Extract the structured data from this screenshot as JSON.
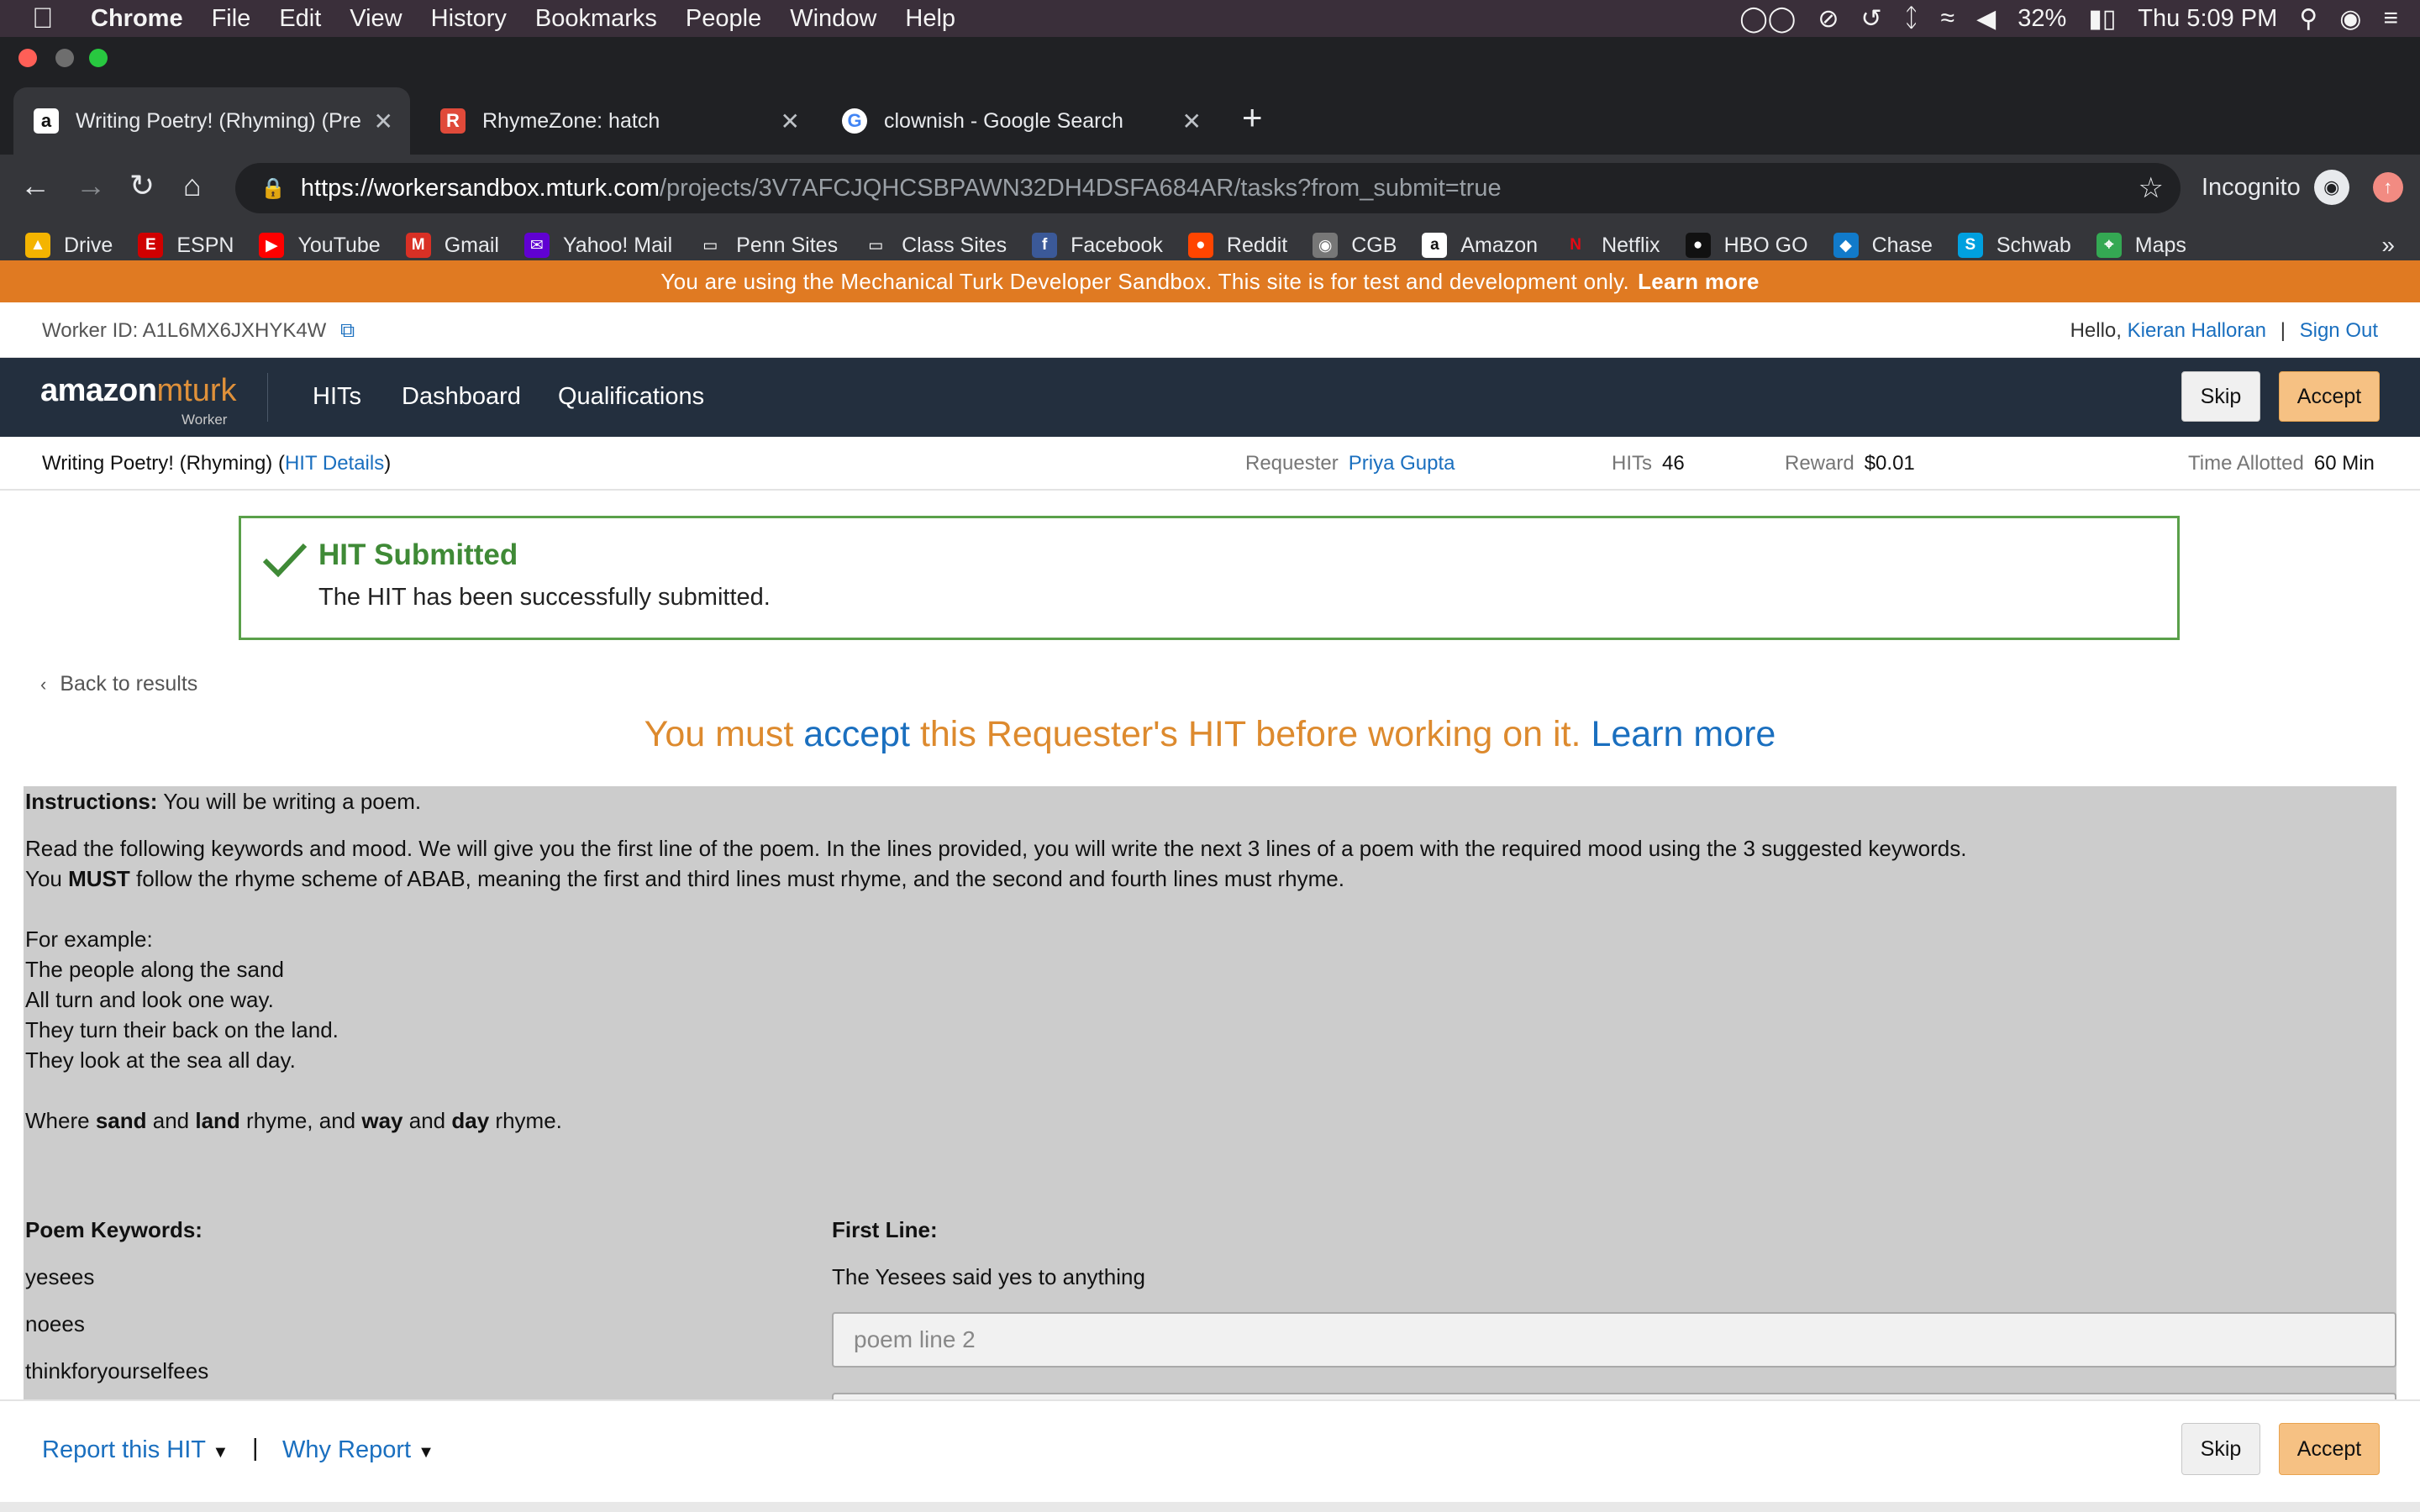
{
  "macos": {
    "menu": [
      "Chrome",
      "File",
      "Edit",
      "View",
      "History",
      "Bookmarks",
      "People",
      "Window",
      "Help"
    ],
    "battery": "32%",
    "clock": "Thu 5:09 PM"
  },
  "tabs": [
    {
      "title": "Writing Poetry! (Rhyming) (Pre",
      "favicon": "a",
      "color": "#ffffff"
    },
    {
      "title": "RhymeZone: hatch",
      "favicon": "R",
      "color": "#e04a3a"
    },
    {
      "title": "clownish - Google Search",
      "favicon": "G",
      "color": "#4285f4"
    }
  ],
  "address": {
    "host": "https://workersandbox.mturk.com",
    "path": "/projects/3V7AFCJQHCSBPAWN32DH4DSFA684AR/tasks?from_submit=true"
  },
  "incognito_label": "Incognito",
  "bookmarks": [
    {
      "label": "Drive",
      "icon": "drive-icon",
      "color": "#f4b400",
      "glyph": "▲"
    },
    {
      "label": "ESPN",
      "icon": "espn-icon",
      "color": "#d00000",
      "glyph": "E"
    },
    {
      "label": "YouTube",
      "icon": "youtube-icon",
      "color": "#ff0000",
      "glyph": "▶"
    },
    {
      "label": "Gmail",
      "icon": "gmail-icon",
      "color": "#d93025",
      "glyph": "M"
    },
    {
      "label": "Yahoo! Mail",
      "icon": "yahoo-mail-icon",
      "color": "#6001d2",
      "glyph": "✉"
    },
    {
      "label": "Penn Sites",
      "icon": "folder-icon",
      "color": "transparent",
      "glyph": "▭"
    },
    {
      "label": "Class Sites",
      "icon": "folder-icon",
      "color": "transparent",
      "glyph": "▭"
    },
    {
      "label": "Facebook",
      "icon": "facebook-icon",
      "color": "#3b5998",
      "glyph": "f"
    },
    {
      "label": "Reddit",
      "icon": "reddit-icon",
      "color": "#ff4500",
      "glyph": "●"
    },
    {
      "label": "CGB",
      "icon": "cgb-icon",
      "color": "#777777",
      "glyph": "◉"
    },
    {
      "label": "Amazon",
      "icon": "amazon-icon",
      "color": "#ffffff",
      "glyph": "a"
    },
    {
      "label": "Netflix",
      "icon": "netflix-icon",
      "color": "transparent",
      "glyph": "N"
    },
    {
      "label": "HBO GO",
      "icon": "hbo-icon",
      "color": "#111111",
      "glyph": "●"
    },
    {
      "label": "Chase",
      "icon": "chase-icon",
      "color": "#117aca",
      "glyph": "◆"
    },
    {
      "label": "Schwab",
      "icon": "schwab-icon",
      "color": "#00a0df",
      "glyph": "S"
    },
    {
      "label": "Maps",
      "icon": "maps-icon",
      "color": "#34a853",
      "glyph": "⌖"
    }
  ],
  "banner": {
    "text": "You are using the Mechanical Turk Developer Sandbox. This site is for test and development only.",
    "link": "Learn more"
  },
  "worker": {
    "id_text": "Worker ID: A1L6MX6JXHYK4W",
    "hello": "Hello,",
    "name": "Kieran Halloran",
    "sep": "|",
    "signout": "Sign Out"
  },
  "nav": {
    "logo_amazon": "amazon",
    "logo_mturk": "mturk",
    "logo_worker": "Worker",
    "items": [
      "HITs",
      "Dashboard",
      "Qualifications"
    ],
    "skip": "Skip",
    "accept": "Accept"
  },
  "hit": {
    "title": "Writing Poetry! (Rhyming)",
    "details": "HIT Details",
    "requester_label": "Requester",
    "requester": "Priya Gupta",
    "hits_label": "HITs",
    "hits": "46",
    "reward_label": "Reward",
    "reward": "$0.01",
    "time_label": "Time Allotted",
    "time": "60 Min"
  },
  "alert": {
    "heading": "HIT Submitted",
    "message": "The HIT has been successfully submitted.",
    "color": "#3f8a36"
  },
  "back": "Back to results",
  "must_accept": {
    "pre": "You must",
    "accept": "accept",
    "mid": "this Requester's HIT before working on it.",
    "learn": "Learn more"
  },
  "task": {
    "instructions_label": "Instructions:",
    "instructions": "You will be writing a poem.",
    "para1": "Read the following keywords and mood. We will give you the first line of the poem. In the lines provided, you will write the next 3 lines of a poem with the required mood using the 3 suggested keywords.",
    "para2_a": "You",
    "para2_b": "MUST",
    "para2_c": "follow the rhyme scheme of ABAB, meaning the first and third lines must rhyme, and the second and fourth lines must rhyme.",
    "example_label": "For example:",
    "example": [
      "The people along the sand",
      "All turn and look one way.",
      "They turn their back on the land.",
      "They look at the sea all day."
    ],
    "where": [
      "Where",
      "sand",
      "and",
      "land",
      "rhyme, and",
      "way",
      "and",
      "day",
      "rhyme."
    ],
    "keywords_label": "Poem Keywords:",
    "keywords": [
      "yesees",
      "noees",
      "thinkforyourselfees"
    ],
    "first_line_label": "First Line:",
    "first_line": "The Yesees said yes to anything",
    "line2_placeholder": "poem line 2"
  },
  "footer": {
    "report": "Report this HIT",
    "sep": "|",
    "why": "Why Report",
    "skip": "Skip",
    "accept": "Accept"
  }
}
